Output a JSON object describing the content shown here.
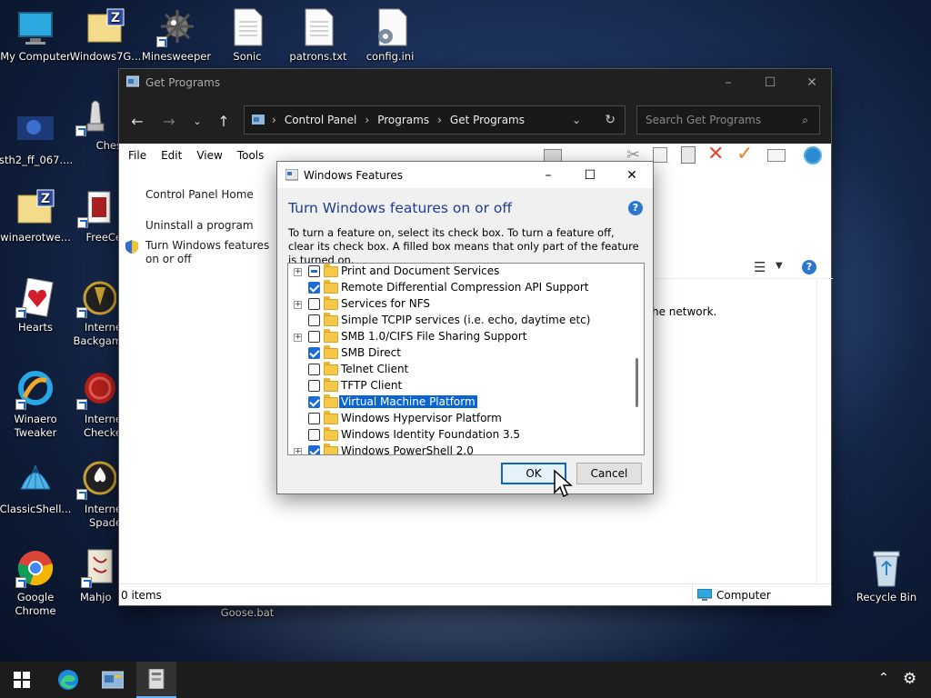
{
  "desktop": {
    "icons": [
      {
        "label": "My Computer",
        "icon": "monitor-icon"
      },
      {
        "label": "Windows7G...",
        "icon": "archive-icon"
      },
      {
        "label": "Minesweeper",
        "icon": "mine-icon"
      },
      {
        "label": "Sonic",
        "icon": "document-icon"
      },
      {
        "label": "patrons.txt",
        "icon": "document-icon"
      },
      {
        "label": "config.ini",
        "icon": "config-file-icon"
      },
      {
        "label": "sth2_ff_067....",
        "icon": "image-icon"
      },
      {
        "label": "Ches",
        "icon": "chess-icon"
      },
      {
        "label": "winaerotwe...",
        "icon": "archive-icon"
      },
      {
        "label": "FreeCe",
        "icon": "cards-icon"
      },
      {
        "label": "Hearts",
        "icon": "hearts-icon"
      },
      {
        "label": "Interne Backgam",
        "icon": "backgammon-icon"
      },
      {
        "label": "Winaero Tweaker",
        "icon": "tweaker-icon"
      },
      {
        "label": "Interne Checke",
        "icon": "checkers-icon"
      },
      {
        "label": "ClassicShell...",
        "icon": "shell-icon"
      },
      {
        "label": "Interne Spade",
        "icon": "spades-icon"
      },
      {
        "label": "Google Chrome",
        "icon": "chrome-icon"
      },
      {
        "label": "Mahjo",
        "icon": "mahjong-icon"
      },
      {
        "label": "Goose.bat",
        "icon": "batch-icon"
      },
      {
        "label": "Recycle Bin",
        "icon": "recycle-bin-icon"
      }
    ]
  },
  "explorer": {
    "title": "Get Programs",
    "breadcrumb": [
      "Control Panel",
      "Programs",
      "Get Programs"
    ],
    "search_placeholder": "Search Get Programs",
    "menu": [
      "File",
      "Edit",
      "View",
      "Tools"
    ],
    "left_links": [
      "Control Panel Home",
      "Uninstall a program",
      "Turn Windows features on or off"
    ],
    "body_fragment": "he network.",
    "status_items": "0 items",
    "status_location": "Computer"
  },
  "dialog": {
    "title": "Windows Features",
    "heading": "Turn Windows features on or off",
    "description": "To turn a feature on, select its check box. To turn a feature off, clear its check box. A filled box means that only part of the feature is turned on.",
    "features": [
      {
        "label": "Print and Document Services",
        "state": "partial",
        "expandable": true
      },
      {
        "label": "Remote Differential Compression API Support",
        "state": "checked",
        "expandable": false
      },
      {
        "label": "Services for NFS",
        "state": "unchecked",
        "expandable": true
      },
      {
        "label": "Simple TCPIP services (i.e. echo, daytime etc)",
        "state": "unchecked",
        "expandable": false
      },
      {
        "label": "SMB 1.0/CIFS File Sharing Support",
        "state": "unchecked",
        "expandable": true
      },
      {
        "label": "SMB Direct",
        "state": "checked",
        "expandable": false
      },
      {
        "label": "Telnet Client",
        "state": "unchecked",
        "expandable": false
      },
      {
        "label": "TFTP Client",
        "state": "unchecked",
        "expandable": false
      },
      {
        "label": "Virtual Machine Platform",
        "state": "checked",
        "expandable": false,
        "selected": true
      },
      {
        "label": "Windows Hypervisor Platform",
        "state": "unchecked",
        "expandable": false
      },
      {
        "label": "Windows Identity Foundation 3.5",
        "state": "unchecked",
        "expandable": false
      },
      {
        "label": "Windows PowerShell 2.0",
        "state": "checked",
        "expandable": true
      }
    ],
    "ok_label": "OK",
    "cancel_label": "Cancel"
  },
  "colors": {
    "accent": "#0a64d1",
    "heading": "#1e3d8f",
    "titlebar_dark": "#202020",
    "taskbar": "#1c1c1c"
  }
}
